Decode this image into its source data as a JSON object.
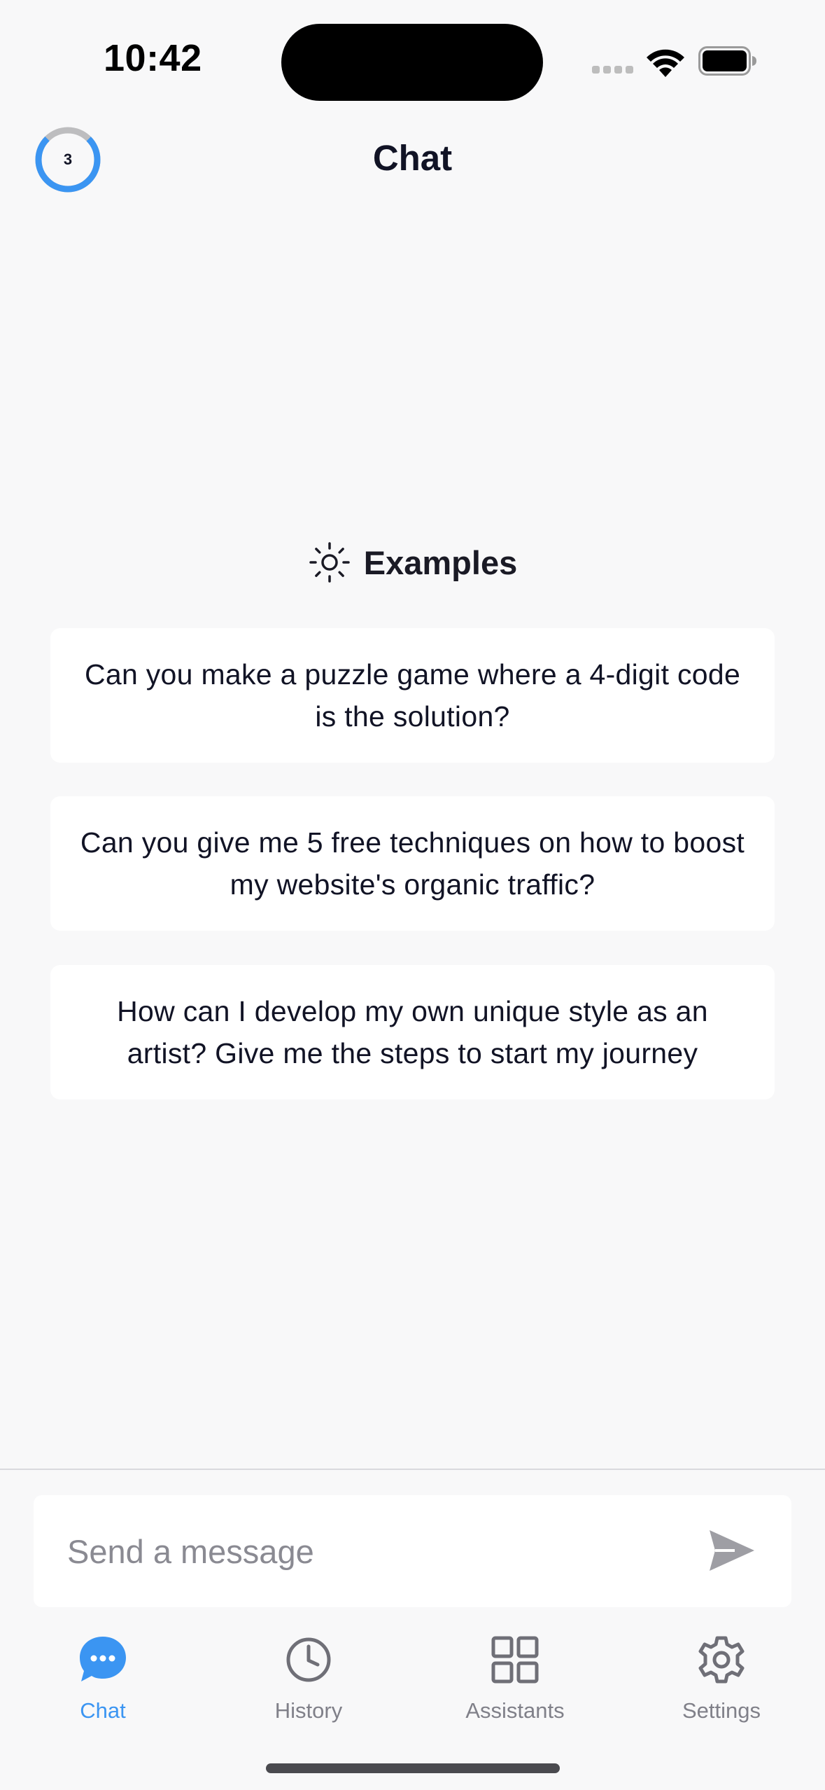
{
  "status_bar": {
    "time": "10:42"
  },
  "header": {
    "title": "Chat",
    "credits_count": "3",
    "credits_progress": 0.75
  },
  "examples": {
    "heading": "Examples",
    "items": [
      {
        "text": "Can you make a puzzle game where a 4-digit code is the solution?"
      },
      {
        "text": "Can you give me 5 free techniques on how to boost my website's organic traffic?"
      },
      {
        "text": "How can I develop my own unique style as an artist? Give me the steps to start my journey"
      }
    ]
  },
  "composer": {
    "placeholder": "Send a message",
    "value": ""
  },
  "tabs": [
    {
      "label": "Chat",
      "icon": "chat-bubble-icon",
      "active": true
    },
    {
      "label": "History",
      "icon": "clock-icon",
      "active": false
    },
    {
      "label": "Assistants",
      "icon": "grid-icon",
      "active": false
    },
    {
      "label": "Settings",
      "icon": "gear-icon",
      "active": false
    }
  ],
  "colors": {
    "accent": "#3b95f2",
    "background": "#f8f8f9",
    "card": "#ffffff",
    "text": "#111325",
    "muted": "#808089"
  }
}
